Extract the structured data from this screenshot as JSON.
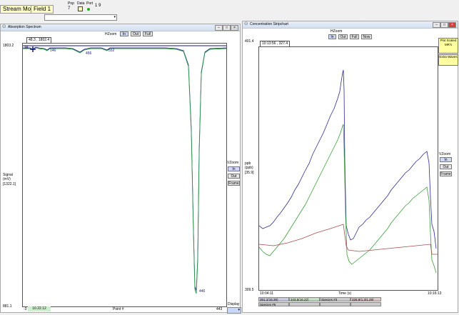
{
  "toolbar": {
    "mode_label": "Stream Mode",
    "field_label": "Field 1",
    "pnp_label": "Pnp",
    "pnp_value": "7",
    "data_label": "Data",
    "port_label": "Port",
    "port_value": "1 9"
  },
  "absorption": {
    "title": "Absorption Spectrum",
    "hzoom_label": "HZoom",
    "btn_in": "In",
    "btn_out": "Out",
    "btn_full": "Full",
    "cursor_readout": "48.3 , 1802.4",
    "ymax": "1803.2",
    "ymin": "881.1",
    "ylabel_line1": "Signal",
    "ylabel_line2": "(mV)",
    "ylabel_line3": "[1322.1]",
    "xmin": "-3",
    "xmax": "443",
    "xlabel": "Point #",
    "timestamp": "10.22.12",
    "vzoom_label": "VZoom",
    "vbtn_in": "In",
    "vbtn_out": "Out",
    "vbtn_frame": "Frame",
    "display_label": "Display",
    "peak_labels": {
      "p1": "16",
      "p2": "146",
      "p3": "456",
      "p4": "552",
      "p5": "446"
    }
  },
  "strip": {
    "title": "Concentration Stripchart",
    "hzoom_label": "HZoom",
    "btn_in": "In",
    "btn_out": "Out",
    "btn_full": "Full",
    "btn_now": "Now",
    "cursor_readout": "10:13:56 , 327.4",
    "ymax": "401.4",
    "ymin": "309.5",
    "ylabel_line1": "ppb",
    "ylabel_line2": "(ppb)",
    "ylabel_line3": "[35.9]",
    "xmin": "10:04:11",
    "xmax": "10:16:13",
    "xlabel": "Time (s)",
    "plot_scaled_btn": "Plot Scaled MR's",
    "extra_waves_btn": "Extra Waves",
    "vzoom_label": "VZoom",
    "vbtn_in": "In",
    "vbtn_out": "Out",
    "vbtn_frame": "Frame",
    "legend": [
      {
        "text": "351.1(16.36)",
        "color": "#5b5ba8"
      },
      {
        "text": "343.5(16.22)",
        "color": "#4f9f4f"
      },
      {
        "text": "Species #3",
        "color": "#666666"
      },
      {
        "text": "328.8(1.3/1.29)",
        "color": "#a05050"
      },
      {
        "text": "Species #5",
        "color": "#666666"
      },
      {
        "text": "",
        "color": "#666666"
      },
      {
        "text": "",
        "color": "#666666"
      },
      {
        "text": "",
        "color": "#666666"
      }
    ],
    "colors": {
      "series1": "#2b2b8f",
      "series2": "#3a9a3a",
      "series3": "#a0504a"
    }
  },
  "spectrum_colors": {
    "line1": "#1a1a7a",
    "line2": "#2f9a4f"
  }
}
